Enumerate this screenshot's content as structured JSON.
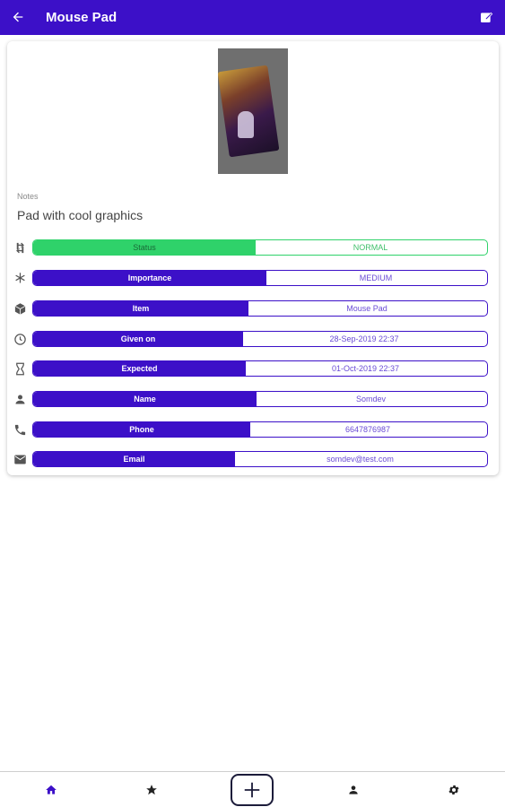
{
  "app": {
    "title": "Mouse Pad"
  },
  "icons": {
    "back": "arrow-left-icon",
    "edit": "edit-icon",
    "status": "sync-icon",
    "importance": "asterisk-icon",
    "item": "cube-icon",
    "given_on": "clock-icon",
    "expected": "hourglass-icon",
    "name": "person-icon",
    "phone": "phone-icon",
    "email": "mail-icon"
  },
  "notes": {
    "label": "Notes",
    "text": "Pad with cool graphics"
  },
  "fields": {
    "status": {
      "label": "Status",
      "value": "NORMAL"
    },
    "importance": {
      "label": "Importance",
      "value": "MEDIUM"
    },
    "item": {
      "label": "Item",
      "value": "Mouse Pad"
    },
    "given_on": {
      "label": "Given on",
      "value": "28-Sep-2019 22:37"
    },
    "expected": {
      "label": "Expected",
      "value": "01-Oct-2019 22:37"
    },
    "name": {
      "label": "Name",
      "value": "Somdev"
    },
    "phone": {
      "label": "Phone",
      "value": "6647876987"
    },
    "email": {
      "label": "Email",
      "value": "somdev@test.com"
    }
  },
  "bottom_nav": {
    "items": [
      "home-icon",
      "star-icon",
      "add-icon",
      "person-icon",
      "settings-icon"
    ],
    "active": "home-icon"
  },
  "colors": {
    "primary": "#3c10c8",
    "status_green": "#2fd26a",
    "value_text": "#6a4bd6"
  }
}
